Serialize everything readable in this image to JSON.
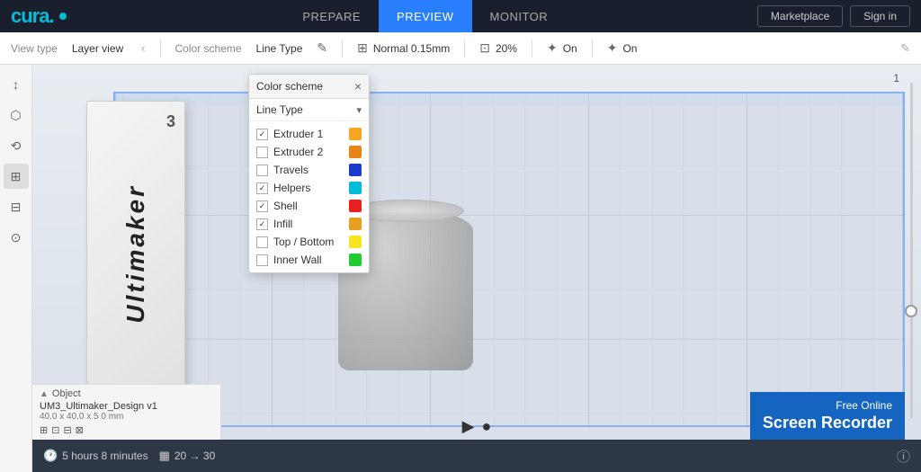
{
  "app": {
    "logo": "cura.",
    "nav": {
      "links": [
        "PREPARE",
        "PREVIEW",
        "MONITOR"
      ],
      "active": "PREVIEW",
      "buttons": [
        "Marketplace",
        "Sign in"
      ]
    }
  },
  "toolbar2": {
    "view_type_label": "View type",
    "view_type_value": "Layer view",
    "color_scheme_label": "Color scheme",
    "color_scheme_value": "Line Type",
    "profile_icon": "⊞",
    "profile_value": "Normal 0.15mm",
    "zoom_value": "20%",
    "fan_label": "On",
    "support_label": "On"
  },
  "color_scheme_popup": {
    "title": "Color scheme",
    "close": "×",
    "dropdown_value": "Line Type",
    "items": [
      {
        "label": "Extruder 1",
        "checked": true,
        "color": "#f5a623"
      },
      {
        "label": "Extruder 2",
        "checked": false,
        "color": "#e8851a"
      },
      {
        "label": "Travels",
        "checked": false,
        "color": "#1a3bcc"
      },
      {
        "label": "Helpers",
        "checked": true,
        "color": "#00bcd4"
      },
      {
        "label": "Shell",
        "checked": true,
        "color": "#e82020"
      },
      {
        "label": "Infill",
        "checked": true,
        "color": "#e8a020"
      },
      {
        "label": "Top / Bottom",
        "checked": false,
        "color": "#f5e520"
      },
      {
        "label": "Inner Wall",
        "checked": false,
        "color": "#20cc30"
      }
    ]
  },
  "sidebar": {
    "icons": [
      "↕",
      "⬡",
      "⬛",
      "⟲",
      "⊞",
      "⊟",
      "⊙"
    ]
  },
  "object_panel": {
    "section_label": "Object",
    "object_name": "UM3_Ultimaker_Design v1",
    "object_size": "40.0 x 40.0 x 5 0 mm",
    "actions": [
      "⊞",
      "⊡",
      "⊟",
      "⊠"
    ]
  },
  "status_bar": {
    "time_icon": "🕐",
    "time_value": "5 hours 8 minutes",
    "bar_icon": "▦",
    "bar_value": "20  →  30"
  },
  "layer_num": "1",
  "watermark": {
    "top": "Free Online",
    "main": "Screen Recorder"
  },
  "bottom_controls": {
    "play": "▶",
    "dot": "●"
  }
}
